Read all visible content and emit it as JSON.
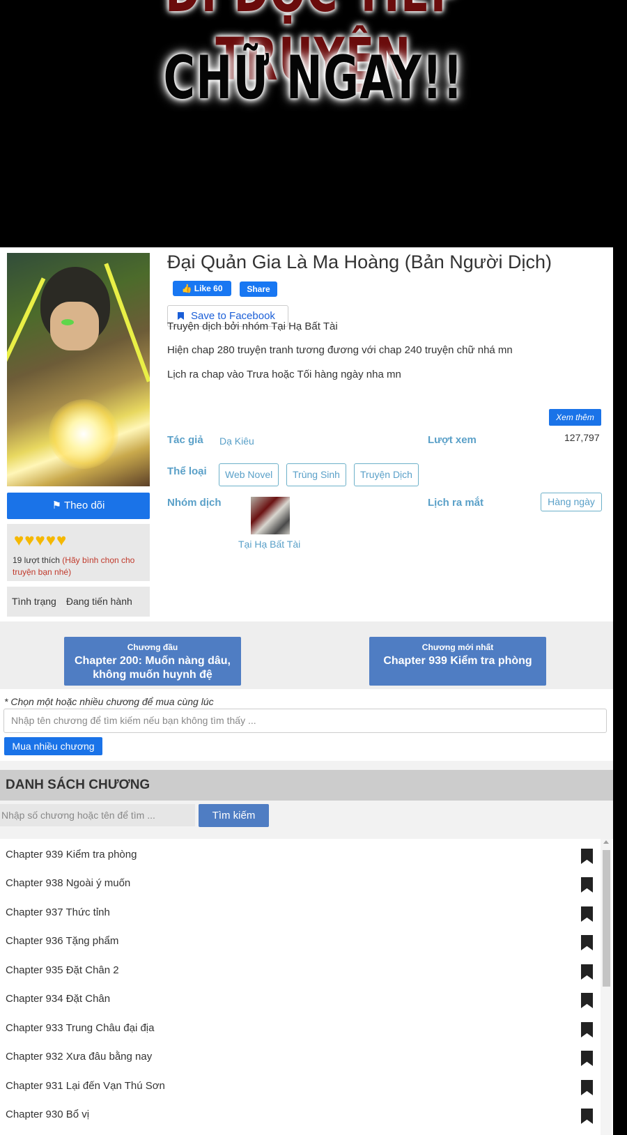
{
  "banner": {
    "line1": "ĐI ĐỌC TIẾP TRUYỆN",
    "line2": "CHỮ NGAY!!"
  },
  "story": {
    "title": "Đại Quản Gia Là Ma Hoàng (Bản Người Dịch)",
    "fb_like": "Like 60",
    "fb_share": "Share",
    "save_facebook": "Save to Facebook",
    "desc1": "Truyện dịch bởi nhóm Tại Hạ Bất Tài",
    "desc2": "Hiện chap 280 truyện tranh tương đương với chap 240 truyện chữ nhá mn",
    "desc3": "Lịch ra chap vào Trưa hoặc Tối hàng ngày nha mn",
    "see_more": "Xem thêm",
    "author_label": "Tác giả",
    "author": "Dạ Kiêu",
    "views_label": "Lượt xem",
    "views": "127,797",
    "genre_label": "Thể loại",
    "genres": [
      "Web Novel",
      "Trùng Sinh",
      "Truyện Dịch"
    ],
    "group_label": "Nhóm dịch",
    "group_name": "Tại Hạ Bất Tài",
    "release_label": "Lịch ra mắt",
    "release": "Hàng ngày",
    "follow": "Theo dõi",
    "rating_hearts": 5,
    "likes": "19 lượt thích",
    "likes_hint": "(Hãy bình chọn cho truyện bạn nhé)",
    "status_label": "Tình trạng",
    "status": "Đang tiến hành"
  },
  "nav": {
    "first_small": "Chương đầu",
    "first_big": "Chapter 200: Muốn nàng dâu, không muốn huynh đệ",
    "latest_small": "Chương mới nhất",
    "latest_big": "Chapter 939 Kiểm tra phòng"
  },
  "buy": {
    "note": "* Chọn một hoặc nhiều chương để mua cùng lúc",
    "placeholder": "Nhập tên chương để tìm kiếm nếu bạn không tìm thấy ...",
    "button": "Mua nhiều chương"
  },
  "list": {
    "heading": "DANH SÁCH CHƯƠNG",
    "search_placeholder": "Nhập số chương hoặc tên để tìm ...",
    "search_button": "Tìm kiếm",
    "chapters": [
      "Chapter 939 Kiểm tra phòng",
      "Chapter 938 Ngoài ý muốn",
      "Chapter 937 Thức tỉnh",
      "Chapter 936 Tặng phẩm",
      "Chapter 935 Đặt Chân 2",
      "Chapter 934 Đặt Chân",
      "Chapter 933 Trung Châu đại địa",
      "Chapter 932 Xưa đâu bằng nay",
      "Chapter 931 Lại đến Vạn Thú Sơn",
      "Chapter 930 Bổ vị"
    ]
  },
  "colors": {
    "primary_blue": "#1a73e8",
    "nav_blue": "#4f7dc3",
    "label_blue": "#5aa0c8",
    "heart": "#f5b800"
  }
}
